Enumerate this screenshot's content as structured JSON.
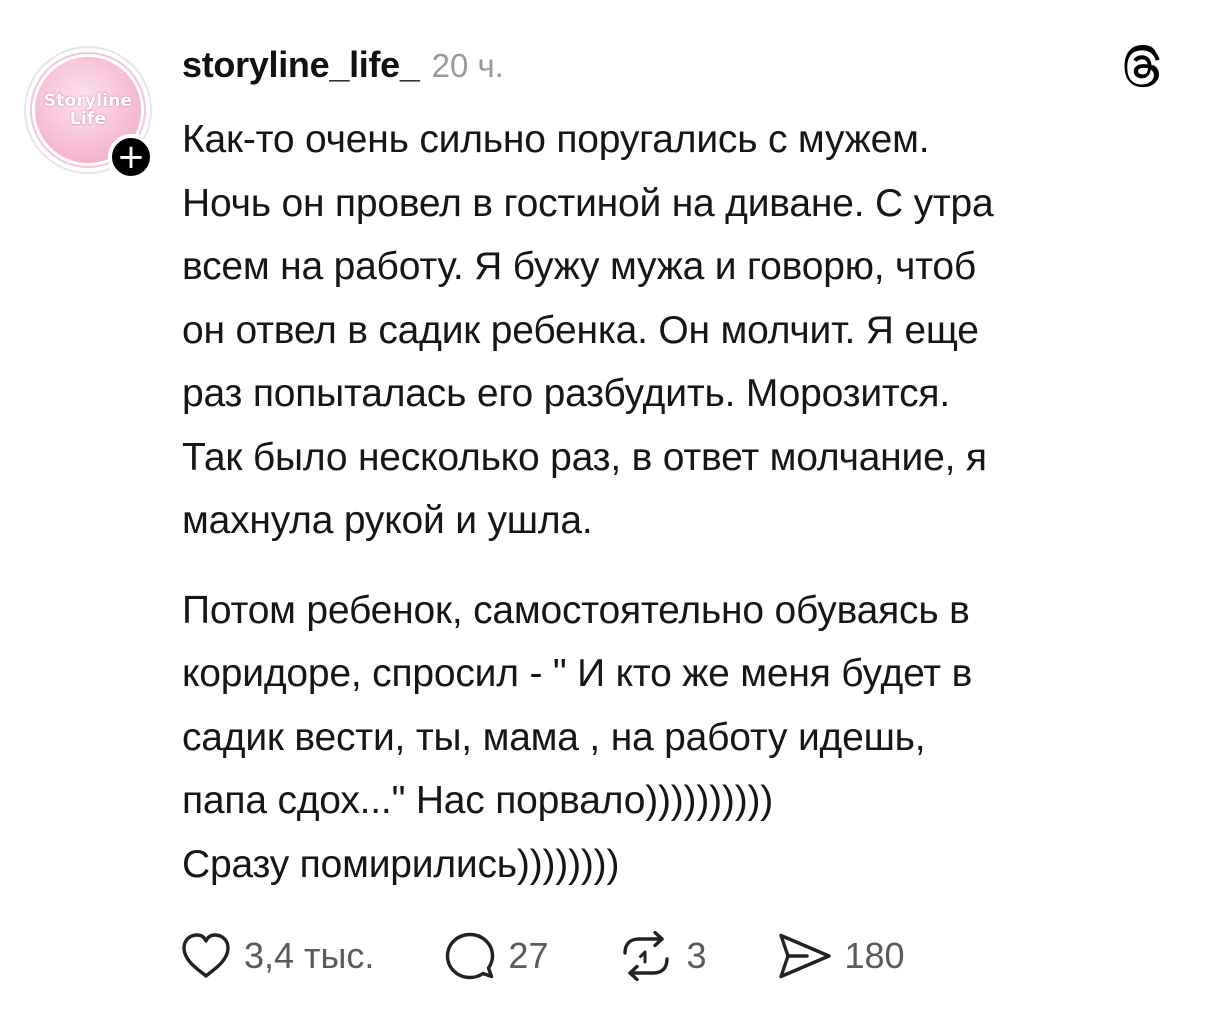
{
  "author": {
    "username": "storyline_life_",
    "avatar_text_line1": "Storyline",
    "avatar_text_line2": "Life",
    "follow_symbol": "+"
  },
  "post": {
    "timestamp": "20 ч.",
    "paragraphs": [
      "Как-то очень сильно поругались с мужем.\nНочь он провел в гостиной на диване. С утра\nвсем на работу. Я бужу мужа и говорю, чтоб\nон отвел в садик ребенка. Он молчит. Я еще\nраз попыталась его разбудить. Морозится.\nТак было несколько раз, в ответ молчание, я\nмахнула рукой и ушла.",
      "Потом ребенок, самостоятельно обуваясь в\nкоридоре, спросил - \" И кто же меня будет в\nсадик вести, ты, мама , на работу идешь,\nпапа сдох...\" Нас порвало))))))))))\nСразу помирились))))))))"
    ]
  },
  "actions": {
    "likes": "3,4 тыс.",
    "replies": "27",
    "reposts": "3",
    "shares": "180"
  },
  "icons": {
    "app": "threads-logo-icon",
    "like": "heart-icon",
    "reply": "comment-bubble-icon",
    "repost": "repost-icon",
    "share": "send-icon"
  },
  "colors": {
    "text": "#161616",
    "muted": "#9a9a9a",
    "avatar_pink": "#f6bfd6"
  }
}
